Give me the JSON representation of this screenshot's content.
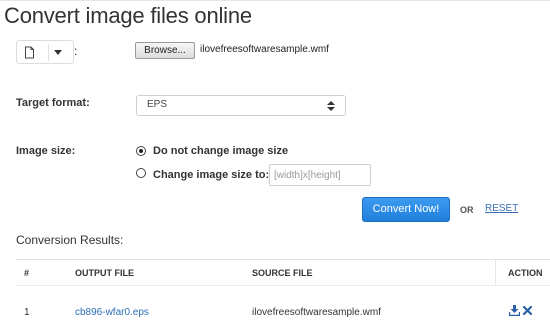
{
  "page": {
    "title": "Convert image files online"
  },
  "source": {
    "colon": ":",
    "browse_label": "Browse...",
    "filename": "ilovefreesoftwaresample.wmf"
  },
  "target_format": {
    "label": "Target format:",
    "selected": "EPS"
  },
  "image_size": {
    "label": "Image size:",
    "option_keep": "Do not change image size",
    "option_change": "Change image size to:",
    "selected": "keep",
    "dims_placeholder": "[width]x[height]",
    "dims_value": ""
  },
  "actions": {
    "convert_label": "Convert Now!",
    "or_text": "OR",
    "reset_label": "RESET"
  },
  "results": {
    "label": "Conversion Results:",
    "columns": [
      "#",
      "OUTPUT FILE",
      "SOURCE FILE",
      "ACTION"
    ],
    "rows": [
      {
        "num": "1",
        "output_file": "cb896-wfar0.eps",
        "source_file": "ilovefreesoftwaresample.wmf"
      }
    ]
  },
  "icons": {
    "file": "file-icon",
    "dropdown": "caret-down-icon",
    "select_arrows": "sort-arrows-icon",
    "download": "download-icon",
    "delete": "delete-icon"
  },
  "colors": {
    "primary_button": "#2a88e6",
    "link": "#2a6db5",
    "action_icons": "#2a62a8"
  }
}
